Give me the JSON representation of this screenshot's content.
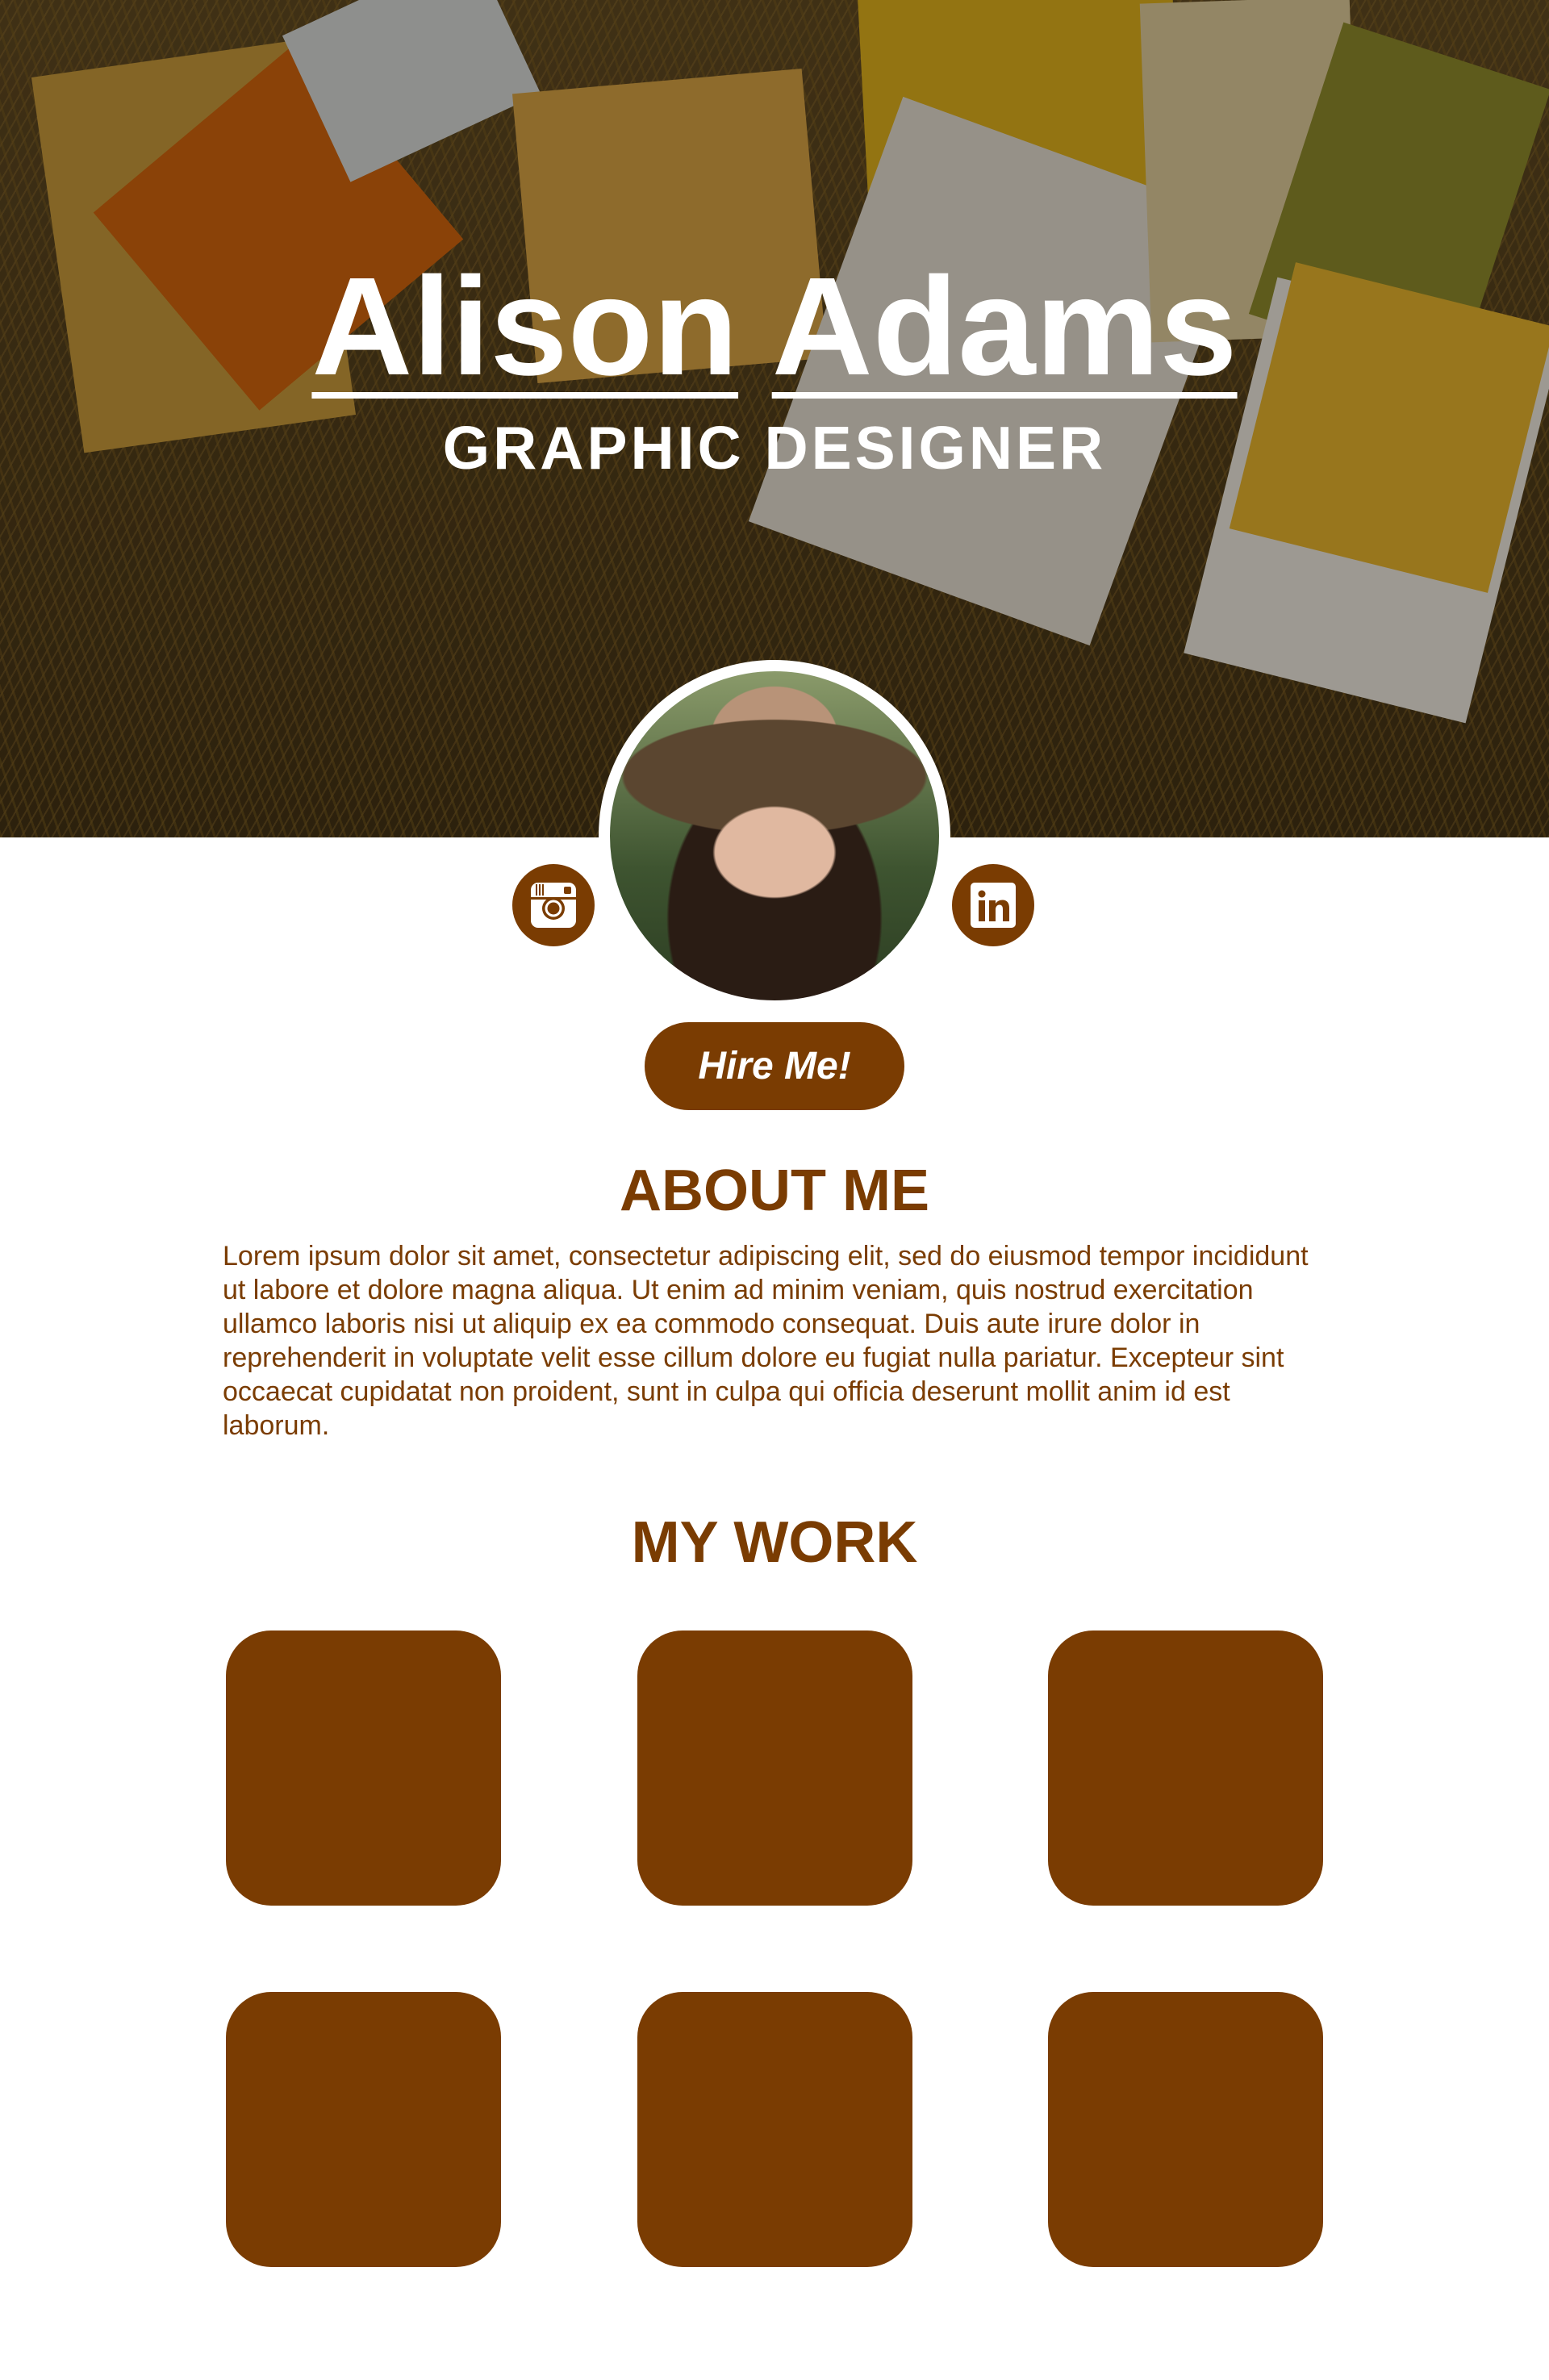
{
  "hero": {
    "first_name": "Alison",
    "last_name": "Adams",
    "subtitle": "GRAPHIC DESIGNER"
  },
  "social": [
    {
      "name": "instagram",
      "icon": "instagram-icon"
    },
    {
      "name": "linkedin",
      "icon": "linkedin-icon"
    }
  ],
  "hire_button": {
    "label": "Hire Me!"
  },
  "about": {
    "heading": "ABOUT ME",
    "text": "Lorem ipsum dolor sit amet, consectetur adipiscing elit, sed do eiusmod tempor incididunt ut labore et dolore magna aliqua. Ut enim ad minim veniam, quis nostrud exercitation ullamco laboris nisi ut aliquip ex ea commodo consequat. Duis aute irure dolor in reprehenderit in voluptate velit esse cillum dolore eu fugiat nulla pariatur. Excepteur sint occaecat cupidatat non proident, sunt in culpa qui officia deserunt mollit anim id est laborum."
  },
  "work": {
    "heading": "MY WORK",
    "items": [
      {},
      {},
      {},
      {},
      {},
      {}
    ]
  },
  "colors": {
    "accent": "#7a3c02",
    "background": "#ffffff",
    "hero_text": "#ffffff"
  }
}
